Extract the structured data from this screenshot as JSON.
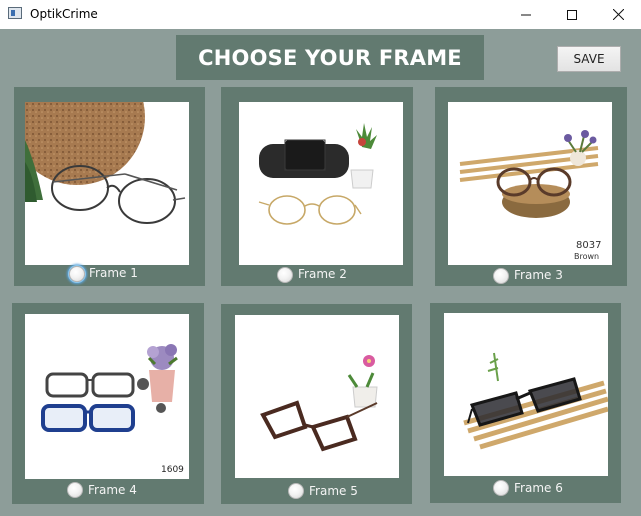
{
  "window": {
    "title": "OptikCrime",
    "minimize_icon": "minimize-icon",
    "maximize_icon": "maximize-icon",
    "close_icon": "close-icon"
  },
  "header": {
    "title": "CHOOSE YOUR FRAME"
  },
  "toolbar": {
    "save_label": "SAVE"
  },
  "frames": [
    {
      "label": "Frame 1",
      "selected": false,
      "focused": true
    },
    {
      "label": "Frame 2",
      "selected": false,
      "focused": false
    },
    {
      "label": "Frame 3",
      "selected": false,
      "focused": false
    },
    {
      "label": "Frame 4",
      "selected": false,
      "focused": false
    },
    {
      "label": "Frame 5",
      "selected": false,
      "focused": false
    },
    {
      "label": "Frame 6",
      "selected": false,
      "focused": false
    }
  ],
  "photo_text": {
    "frame3_code": "8037",
    "frame3_color": "Brown",
    "frame4_code": "1609"
  },
  "colors": {
    "background": "#8d9d99",
    "card": "#627a70",
    "header": "#627a70"
  }
}
